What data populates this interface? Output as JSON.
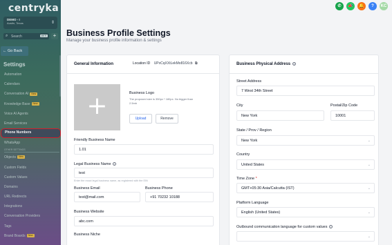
{
  "sidebar": {
    "logo": "centryka",
    "account": {
      "name": "DEMO - I",
      "location": "Austin, Texas"
    },
    "search": {
      "placeholder": "Search",
      "shortcut": "ctrl K"
    },
    "go_back": "Go Back",
    "section_title": "Settings",
    "items": [
      {
        "label": "Automation"
      },
      {
        "label": "Calendars"
      },
      {
        "label": "Conversation AI",
        "badge": "New"
      },
      {
        "label": "Knowledge Base",
        "badge": "New"
      },
      {
        "label": "Voice AI Agents"
      },
      {
        "label": "Email Services"
      },
      {
        "label": "Phone Numbers"
      },
      {
        "label": "WhatsApp"
      },
      {
        "label": "OTHER SETTINGS"
      },
      {
        "label": "Objects",
        "badge": "New"
      },
      {
        "label": "Custom Fields"
      },
      {
        "label": "Custom Values"
      },
      {
        "label": "Domains"
      },
      {
        "label": "URL Redirects"
      },
      {
        "label": "Integrations"
      },
      {
        "label": "Conversation Providers"
      },
      {
        "label": "Tags"
      },
      {
        "label": "Brand Boards",
        "badge": "New"
      }
    ]
  },
  "topbar": {
    "icons": [
      "phone-icon",
      "megaphone-icon",
      "bell-icon",
      "help-icon",
      "user-avatar"
    ],
    "avatar_initials": "KC"
  },
  "page": {
    "title": "Business Profile Settings",
    "subtitle": "Manage your business profile information & settings"
  },
  "general": {
    "heading": "General Information",
    "location_id_label": "Location ID",
    "location_id_value": "UPxCqXXtLekMo816Xcb",
    "logo_title": "Business Logo",
    "logo_desc": "The proposed size is 350px * 180px. No bigger than 2.5mb",
    "upload_label": "Upload",
    "remove_label": "Remove",
    "friendly_name_label": "Friendly Business Name",
    "friendly_name_value": "1.01",
    "legal_name_label": "Legal Business Name",
    "legal_name_value": "test",
    "legal_name_hint": "Enter the exact legal business name, as registered with the EIN",
    "email_label": "Business Email",
    "email_value": "test@mail.com",
    "phone_label": "Business Phone",
    "phone_value": "+91 70232 10188",
    "website_label": "Business Website",
    "website_value": "abc.com",
    "niche_label": "Business Niche"
  },
  "address": {
    "heading": "Business Physical Address",
    "street_label": "Street Address",
    "street_value": "7 West 34th Street",
    "city_label": "City",
    "city_value": "New York",
    "zip_label": "Postal/Zip Code",
    "zip_value": "10001",
    "state_label": "State / Prov / Region",
    "state_value": "New York",
    "country_label": "Country",
    "country_value": "United States",
    "timezone_label": "Time Zone",
    "timezone_value": "GMT+05:30 Asia/Calcutta (IST)",
    "platform_lang_label": "Platform Language",
    "platform_lang_value": "English (United States)",
    "outbound_lang_label": "Outbound communication language for custom values"
  }
}
